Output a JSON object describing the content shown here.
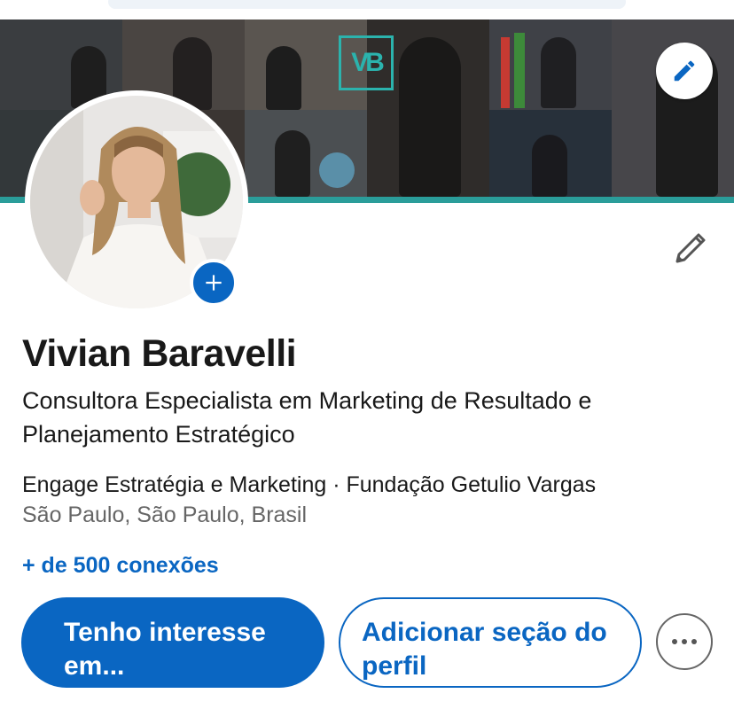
{
  "profile": {
    "name": "Vivian Baravelli",
    "headline": "Consultora Especialista em Marketing de Resultado e Planejamento Estratégico",
    "organizations": "Engage Estratégia e Marketing · Fundação Getulio Vargas",
    "location": "São Paulo, São Paulo, Brasil",
    "connections": "+ de 500 conexões"
  },
  "banner": {
    "logo_text": "VB",
    "accent_color": "#2a9d9a"
  },
  "actions": {
    "primary_label": "Tenho interesse em...",
    "secondary_label": "Adicionar seção do perfil",
    "more_icon": "more-horizontal-icon"
  },
  "icons": {
    "banner_edit": "pencil-icon",
    "profile_edit": "pencil-outline-icon",
    "avatar_add": "plus-icon"
  },
  "colors": {
    "brand": "#0a66c2",
    "secondary_text": "#666666"
  }
}
